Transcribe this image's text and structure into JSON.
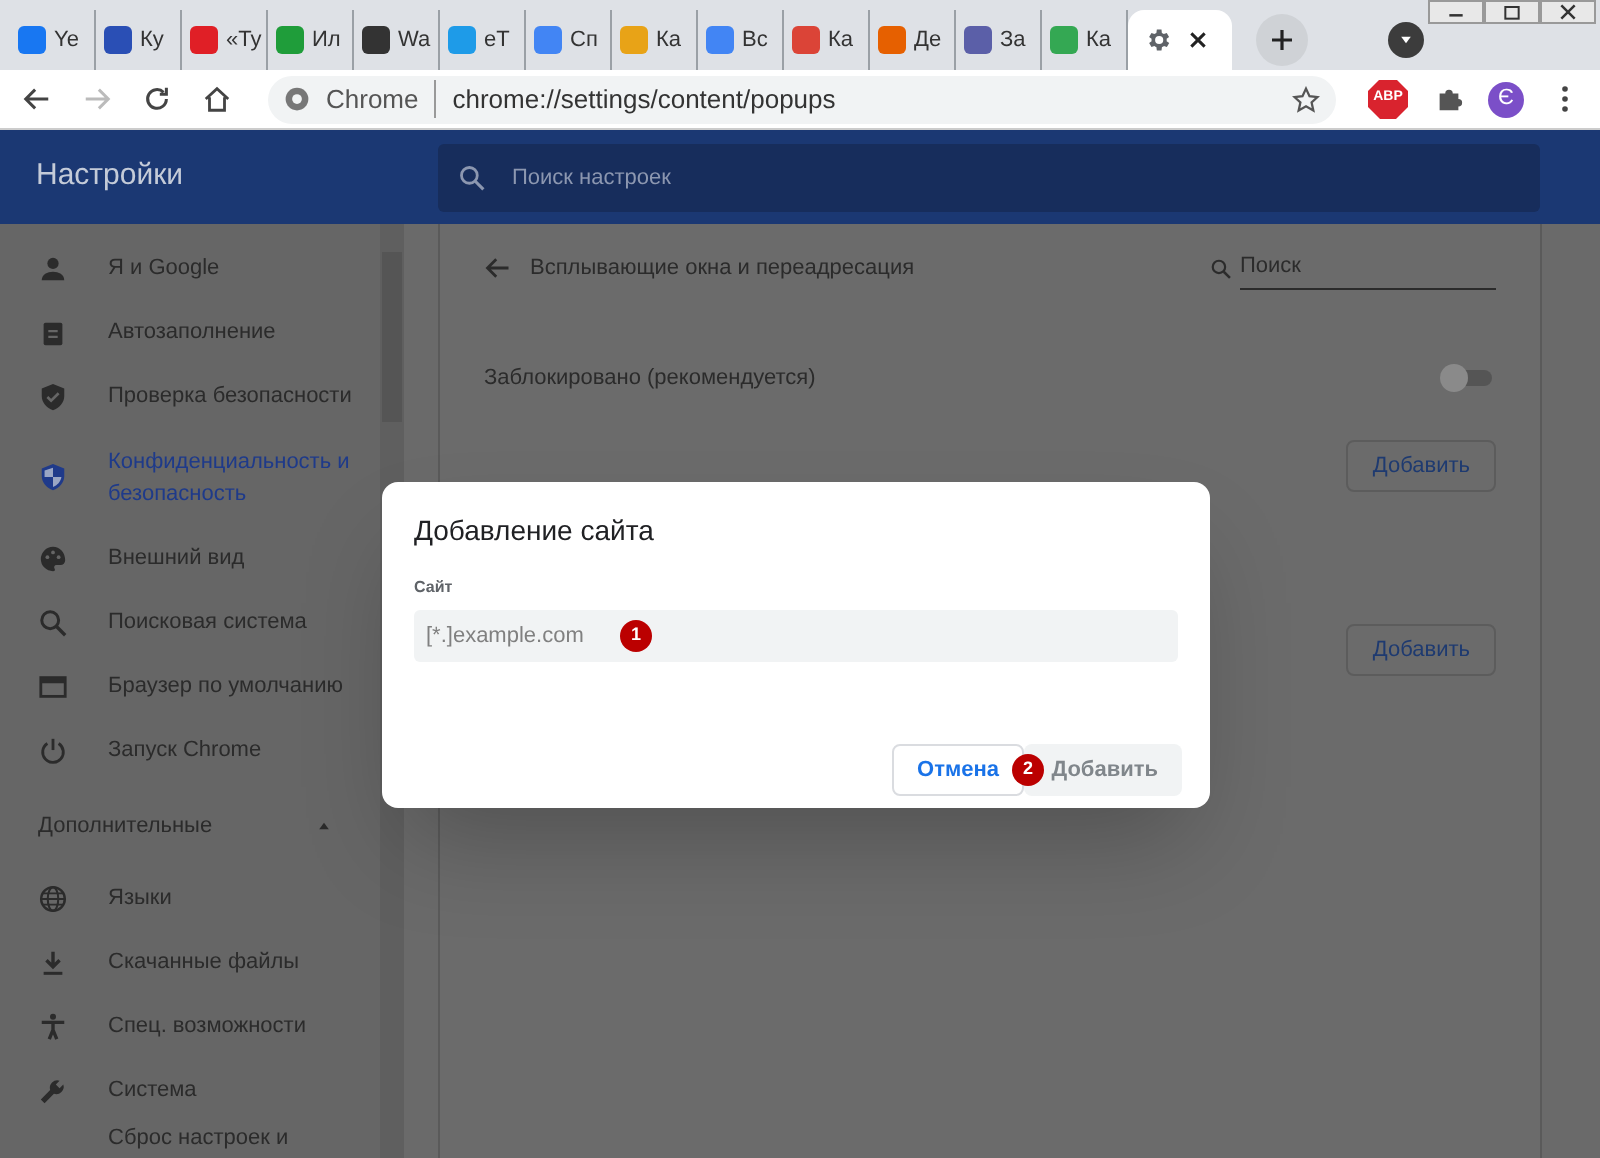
{
  "tabs": [
    {
      "label": "Ye",
      "color": "#1877f2",
      "selected": false
    },
    {
      "label": "Ку",
      "color": "#2a4fb5",
      "selected": false
    },
    {
      "label": "«Ту",
      "color": "#e01f26",
      "selected": false
    },
    {
      "label": "Ил",
      "color": "#1f9d3a",
      "selected": false
    },
    {
      "label": "Wa",
      "color": "#333333",
      "selected": false
    },
    {
      "label": "eT",
      "color": "#1e9be8",
      "selected": false
    },
    {
      "label": "Сп",
      "color": "#4285f4",
      "selected": false
    },
    {
      "label": "Ка",
      "color": "#e8a317",
      "selected": false
    },
    {
      "label": "Вс",
      "color": "#4285f4",
      "selected": false
    },
    {
      "label": "Ка",
      "color": "#db4437",
      "selected": false
    },
    {
      "label": "Де",
      "color": "#e66000",
      "selected": false
    },
    {
      "label": "За",
      "color": "#5b5fa8",
      "selected": false
    },
    {
      "label": "Ка",
      "color": "#34a853",
      "selected": false
    },
    {
      "color": "#5f6368",
      "selected": true
    }
  ],
  "toolbar": {
    "site_chip": "Chrome",
    "url": "chrome://settings/content/popups",
    "forward_disabled": true,
    "profile_letter": "Є",
    "extension_badge": "ABP"
  },
  "header": {
    "title": "Настройки",
    "search_placeholder": "Поиск настроек"
  },
  "sidebar": {
    "items": [
      {
        "label": "Я и Google",
        "selected": false
      },
      {
        "label": "Автозаполнение",
        "selected": false
      },
      {
        "label": "Проверка безопасности",
        "selected": false
      },
      {
        "label": "Конфиденциальность и безопасность",
        "selected": true
      },
      {
        "label": "Внешний вид",
        "selected": false
      },
      {
        "label": "Поисковая система",
        "selected": false
      },
      {
        "label": "Браузер по умолчанию",
        "selected": false
      },
      {
        "label": "Запуск Chrome",
        "selected": false
      }
    ],
    "section": {
      "label": "Дополнительные",
      "expanded": true
    },
    "advanced_items": [
      {
        "label": "Языки",
        "selected": false
      },
      {
        "label": "Скачанные файлы",
        "selected": false
      },
      {
        "label": "Спец. возможности",
        "selected": false
      },
      {
        "label": "Система",
        "selected": false
      },
      {
        "label": "Сброс настроек и",
        "selected": false
      }
    ]
  },
  "page": {
    "title": "Всплывающие окна и переадресация",
    "search_placeholder": "Поиск",
    "toggle_label": "Заблокировано (рекомендуется)",
    "toggle_on": false,
    "add_buttons": [
      "Добавить",
      "Добавить"
    ]
  },
  "dialog": {
    "title": "Добавление сайта",
    "field_label": "Сайт",
    "placeholder": "[*.]example.com",
    "cancel": "Отмена",
    "add": "Добавить",
    "add_disabled": true,
    "markers": [
      "1",
      "2"
    ]
  }
}
